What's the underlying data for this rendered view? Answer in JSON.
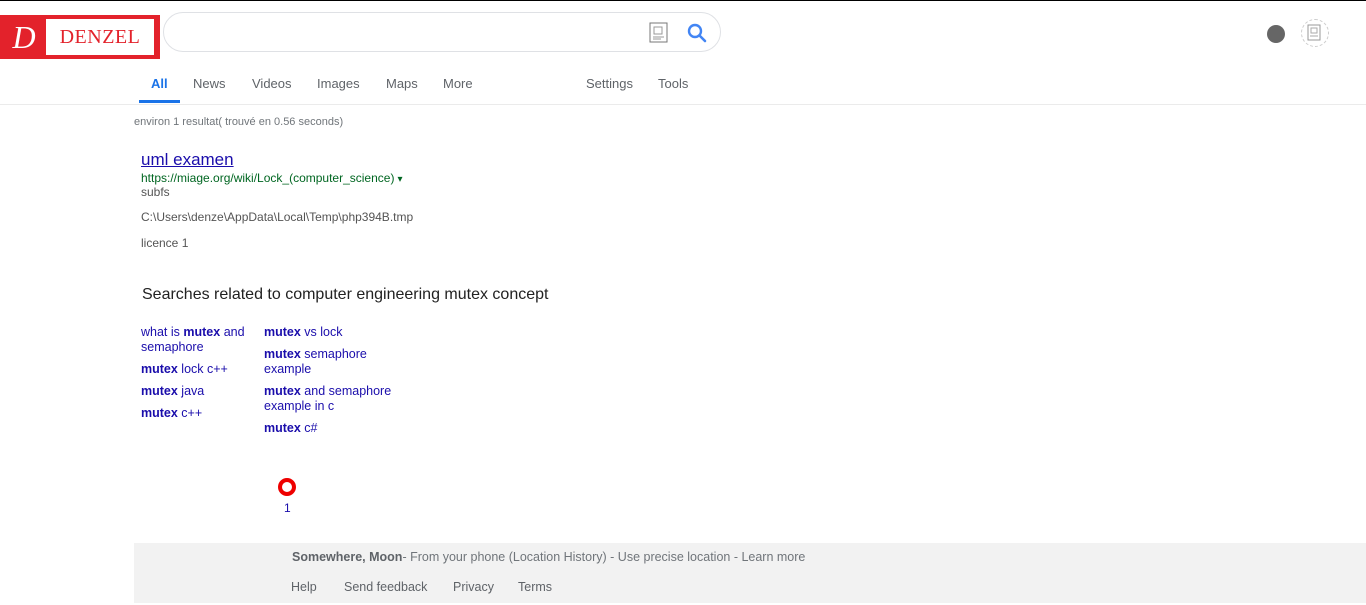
{
  "logo": {
    "mark": "D",
    "text": "DENZEL"
  },
  "search": {
    "value": "",
    "placeholder": ""
  },
  "tabs": [
    {
      "label": "All"
    },
    {
      "label": "News"
    },
    {
      "label": "Videos"
    },
    {
      "label": "Images"
    },
    {
      "label": "Maps"
    },
    {
      "label": "More"
    },
    {
      "label": "Settings"
    },
    {
      "label": "Tools"
    }
  ],
  "stats": "environ 1 resultat( trouvé en 0.56 seconds)",
  "result": {
    "title": "uml examen",
    "url": "https://miage.org/wiki/Lock_(computer_science)",
    "url_arrow": "▾",
    "line1": "subfs",
    "line2": "C:\\Users\\denze\\AppData\\Local\\Temp\\php394B.tmp",
    "line3": "licence 1"
  },
  "related": {
    "heading": "Searches related to computer engineering mutex concept",
    "col1": [
      {
        "pre": "what is ",
        "bold": "mutex",
        "post": " and semaphore"
      },
      {
        "pre": "",
        "bold": "mutex",
        "post": " lock c++"
      },
      {
        "pre": "",
        "bold": "mutex",
        "post": " java"
      },
      {
        "pre": "",
        "bold": "mutex",
        "post": " c++"
      }
    ],
    "col2": [
      {
        "pre": "",
        "bold": "mutex",
        "post": " vs lock"
      },
      {
        "pre": "",
        "bold": "mutex",
        "post": " semaphore example"
      },
      {
        "pre": "",
        "bold": "mutex",
        "post": " and semaphore example in c"
      },
      {
        "pre": "",
        "bold": "mutex",
        "post": " c#"
      }
    ]
  },
  "pager": {
    "page": "1"
  },
  "footer": {
    "location_bold": "Somewhere, Moon",
    "location_text": "- From your phone (Location History) - Use precise location - Learn more",
    "links": [
      "Help",
      "Send feedback",
      "Privacy",
      "Terms"
    ]
  },
  "colors": {
    "brand": "#e3222b",
    "accent": "#1a73e8",
    "link": "#1a0dab",
    "url": "#006621"
  }
}
